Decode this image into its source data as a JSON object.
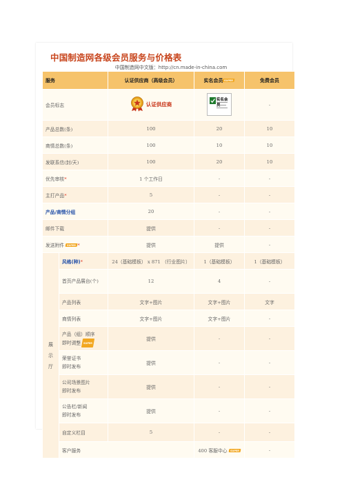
{
  "title": "中国制造网各级会员服务与价格表",
  "subtitle": "中国制造网中文版：http://cn.made-in-china.com",
  "headers": [
    "服务",
    "认证供应商（高级会员）",
    "实名会员",
    "免费会员"
  ],
  "new_badge": "SUPER",
  "emblem": {
    "text": "认证供应商",
    "icon": "gold-medal-icon"
  },
  "cert": {
    "title": "实名会员",
    "icon": "checkmark-icon"
  },
  "rows": {
    "member_logo": {
      "label": "会员标志",
      "free": "-"
    },
    "product_total": {
      "label": "产品总数(条)",
      "gold": "100",
      "real": "20",
      "free": "10"
    },
    "trade_total": {
      "label": "商情总数(条)",
      "gold": "100",
      "real": "10",
      "free": "10"
    },
    "inquiry": {
      "label": "发联系信(封/天)",
      "gold": "100",
      "real": "20",
      "free": "10"
    },
    "priority_review": {
      "label": "优先审核",
      "star": "*",
      "gold": "1 个工作日",
      "real": "-",
      "free": "-"
    },
    "main_products": {
      "label": "主打产品",
      "star": "*",
      "gold": "5",
      "real": "-",
      "free": "-"
    },
    "groups": {
      "label": "产品/商情分组",
      "gold": "20",
      "real": "-",
      "free": "-"
    },
    "email_download": {
      "label": "邮件下载",
      "gold": "提供",
      "real": "-",
      "free": "-"
    },
    "attachments": {
      "label": "发送附件",
      "star": "*",
      "gold": "提供",
      "real": "提供",
      "free": "-"
    },
    "showroom_label": "展 示 厅",
    "style": {
      "label": "风格(种)",
      "star": "*",
      "gold": "24（基础模板） x 871 （行业图片）",
      "real": "1（基础模板）",
      "free": "1（基础模板）"
    },
    "home_display": {
      "label": "首页产品展台(个)",
      "gold": "12",
      "real": "4",
      "free": "-"
    },
    "product_list": {
      "label": "产品列表",
      "gold": "文字+图片",
      "real": "文字+图片",
      "free": "文字"
    },
    "trade_list": {
      "label": "商情列表",
      "gold": "文字+图片",
      "real": "文字+图片",
      "free": "-"
    },
    "group_order": {
      "label1": "产品（组）顺序",
      "label2": "即时调整",
      "gold": "提供",
      "real": "-",
      "free": "-"
    },
    "honor_cert": {
      "label1": "荣誉证书",
      "label2": "即时发布",
      "gold": "提供",
      "real": "-",
      "free": "-"
    },
    "company_photos": {
      "label1": "公司场景图片",
      "label2": "即时发布",
      "gold": "提供",
      "real": "-",
      "free": "-"
    },
    "bulletin": {
      "label1": "公告栏/新闻",
      "label2": "即时发布",
      "gold": "提供",
      "real": "-",
      "free": "-"
    },
    "custom_column": {
      "label": "自定义栏目",
      "gold": "5",
      "real": "-",
      "free": "-"
    },
    "customer_service": {
      "label": "客户服务",
      "gold": "400 客服中心",
      "real": "-",
      "free": "-"
    }
  }
}
